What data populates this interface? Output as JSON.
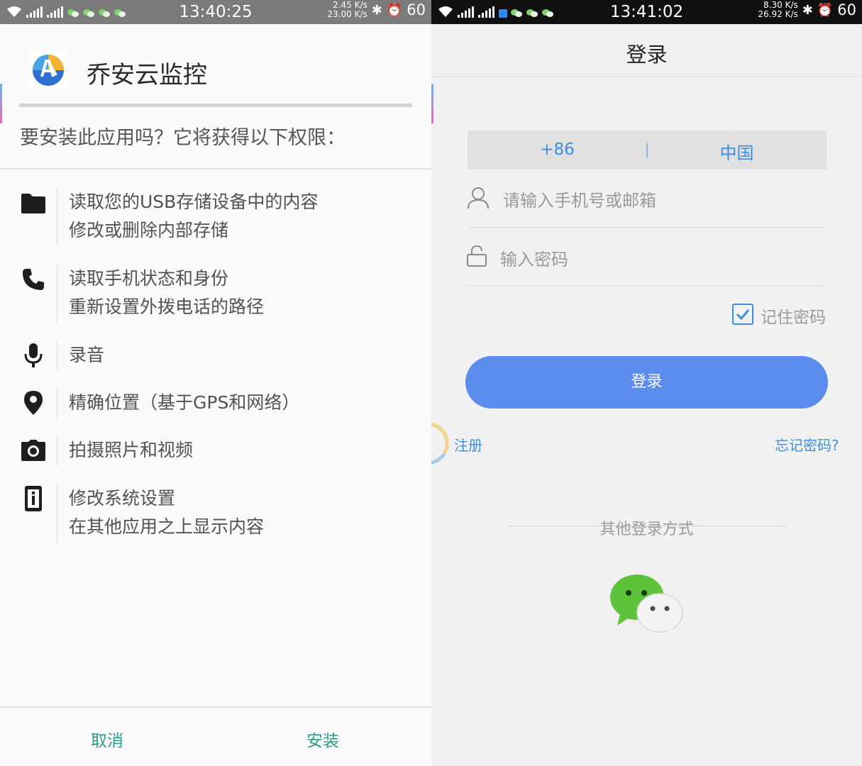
{
  "left": {
    "status": {
      "time": "13:40:25",
      "net_up": "2.45 K/s",
      "net_down": "23.00 K/s",
      "battery": "60"
    },
    "app_title": "乔安云监控",
    "prompt": "要安装此应用吗？它将获得以下权限：",
    "permissions": [
      {
        "icon": "folder-icon",
        "lines": [
          "读取您的USB存储设备中的内容",
          "修改或删除内部存储"
        ]
      },
      {
        "icon": "phone-icon",
        "lines": [
          "读取手机状态和身份",
          "重新设置外拨电话的路径"
        ]
      },
      {
        "icon": "microphone-icon",
        "lines": [
          "录音"
        ]
      },
      {
        "icon": "location-pin-icon",
        "lines": [
          "精确位置（基于GPS和网络）"
        ]
      },
      {
        "icon": "camera-icon",
        "lines": [
          "拍摄照片和视频"
        ]
      },
      {
        "icon": "system-settings-icon",
        "lines": [
          "修改系统设置",
          "在其他应用之上显示内容"
        ]
      }
    ],
    "cancel_label": "取消",
    "install_label": "安装"
  },
  "right": {
    "status": {
      "time": "13:41:02",
      "net_up": "8.30 K/s",
      "net_down": "26.92 K/s",
      "battery": "60"
    },
    "title": "登录",
    "country_code": "+86",
    "country": "中国",
    "phone_placeholder": "请输入手机号或邮箱",
    "password_placeholder": "输入密码",
    "remember_label": "记住密码",
    "remember_checked": true,
    "login_label": "登录",
    "register_label": "注册",
    "forgot_label": "忘记密码?",
    "other_login_label": "其他登录方式"
  },
  "colors": {
    "accent_blue": "#5b8def",
    "link_blue": "#3d8fde",
    "install_green": "#2b9a8a",
    "wechat_green": "#5dc33a"
  }
}
